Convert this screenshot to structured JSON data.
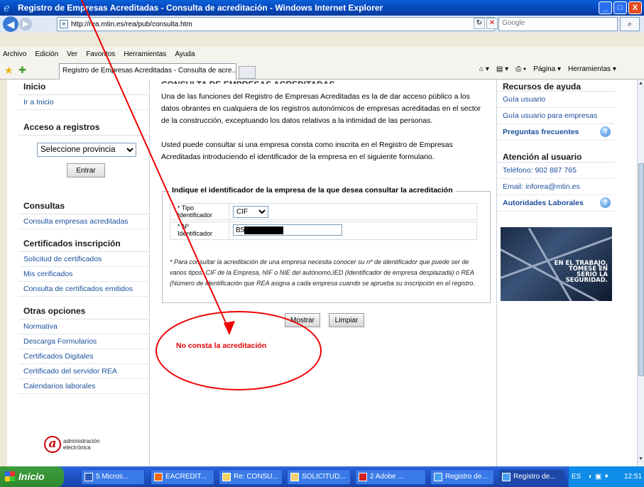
{
  "window": {
    "title": "Registro de Empresas Acreditadas - Consulta de acreditación - Windows Internet Explorer",
    "buttons": {
      "minimize": "_",
      "maximize": "□",
      "close": "X"
    }
  },
  "address": {
    "url": "http://rea.mtin.es/rea/pub/consulta.htm",
    "search_placeholder": "Google"
  },
  "menu": [
    "Archivo",
    "Edición",
    "Ver",
    "Favoritos",
    "Herramientas",
    "Ayuda"
  ],
  "tab": {
    "label": "Registro de Empresas Acreditadas - Consulta de acre..."
  },
  "commandbar": {
    "pagina": "Página ▾",
    "herramientas": "Herramientas ▾"
  },
  "left": {
    "inicio_head": "Inicio",
    "ir_inicio": "Ir a Inicio",
    "acceso_head": "Acceso a registros",
    "provincia_selected": "Seleccione provincia",
    "entrar": "Entrar",
    "consultas_head": "Consultas",
    "consulta_empresas": "Consulta empresas acreditadas",
    "certificados_head": "Certificados inscripción",
    "cert_items": [
      "Solicitud de certificados",
      "Mis cerificados",
      "Consulta de certificados emitidos"
    ],
    "otras_head": "Otras opciones",
    "otras_items": [
      "Normativa",
      "Descarga Formularios",
      "Certificados Digitales",
      "Certificado del servidor REA",
      "Calendarios laborales"
    ],
    "logo_line1": "administración",
    "logo_line2": "electrónica"
  },
  "center": {
    "title": "CONSULTA DE EMPRESAS ACREDITADAS",
    "para1": "Una de las funciones del Registro de Empresas Acreditadas es la de dar acceso público a los datos obrantes en cualquiera de los registros autonómicos de empresas acreditadas en el sector de la construcción, exceptuando los datos relativos a la intimidad de las personas.",
    "para2": "Usted puede consultar si una empresa consta como inscrita en el Registro de Empresas Acreditadas introduciendo el identificador de la empresa en el siguiente formulario.",
    "legend": "Indique el identificador de la empresa de la que desea consultar la acreditación",
    "tipo_label": "* Tipo Identificador",
    "tipo_value": "CIF",
    "num_label": "* Nº Identificador",
    "num_value": "B5",
    "note": "* Para consultar la acreditación de una empresa necesita conocer su nº de identificador que puede ser de varios tipos: CIF de la Empresa, NIF o NIE del autónomo,IED (Identificador de empresa desplazada) o REA (Número de identificación que REA asigna a cada empresa cuando se aprueba su inscripción en el registro.",
    "mostrar": "Mostrar",
    "limpiar": "Limpiar",
    "result": "No consta la acreditación"
  },
  "right": {
    "recursos_head": "Recursos de ayuda",
    "guia_usuario": "Guía usuario",
    "guia_empresas": "Guía usuario para empresas",
    "preguntas": "Preguntas frecuentes",
    "atencion_head": "Atención al usuario",
    "telefono": "Teléfono:  902 887 765",
    "email": "Email: inforea@mtin.es",
    "autoridades": "Autoridades Laborales",
    "banner_text": "EN EL TRABAJO, TÓMESE EN SERIO LA SEGURIDAD."
  },
  "taskbar": {
    "start": "Inicio",
    "tasks": [
      "5 Micros...",
      "EACREDIT...",
      "Re: CONSU...",
      "SOLICITUD...",
      "2 Adobe ...",
      "Registro de...",
      "Registro de..."
    ],
    "lang": "ES",
    "clock": "12:51"
  },
  "colors": {
    "annotation": "#e00000",
    "link": "#1a4f9c"
  }
}
